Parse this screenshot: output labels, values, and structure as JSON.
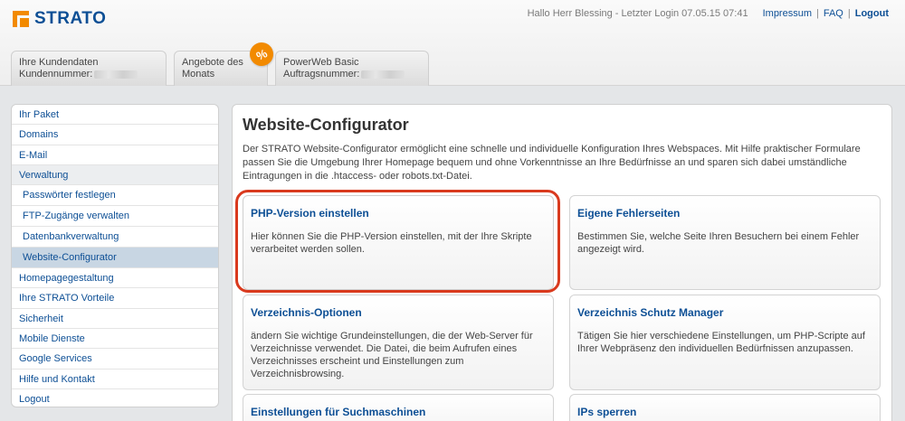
{
  "brand": {
    "name": "STRATO",
    "accent": "#f28a00",
    "link_color": "#0d4f95"
  },
  "topbar": {
    "greeting": "Hallo Herr Blessing - Letzter Login 07.05.15 07:41",
    "links": {
      "impressum": "Impressum",
      "faq": "FAQ",
      "logout": "Logout"
    },
    "separator": "|"
  },
  "tabs": [
    {
      "line1": "Ihre Kundendaten",
      "line2": "Kundennummer:"
    },
    {
      "line1": "Angebote des",
      "line2": "Monats",
      "badge": "%"
    },
    {
      "line1": "PowerWeb Basic",
      "line2": "Auftragsnummer:"
    }
  ],
  "sidebar": {
    "items": [
      {
        "label": "Ihr Paket"
      },
      {
        "label": "Domains"
      },
      {
        "label": "E-Mail"
      },
      {
        "label": "Verwaltung"
      },
      {
        "label": "Passwörter festlegen"
      },
      {
        "label": "FTP-Zugänge verwalten"
      },
      {
        "label": "Datenbankverwaltung"
      },
      {
        "label": "Website-Configurator"
      },
      {
        "label": "Homepagegestaltung"
      },
      {
        "label": "Ihre STRATO Vorteile"
      },
      {
        "label": "Sicherheit"
      },
      {
        "label": "Mobile Dienste"
      },
      {
        "label": "Google Services"
      },
      {
        "label": "Hilfe und Kontakt"
      },
      {
        "label": "Logout"
      }
    ]
  },
  "main": {
    "title": "Website-Configurator",
    "intro": "Der STRATO Website-Configurator ermöglicht eine schnelle und individuelle Konfiguration Ihres Webspaces. Mit Hilfe praktischer Formulare passen Sie die Umgebung Ihrer Homepage bequem und ohne Vorkenntnisse an Ihre Bedürfnisse an und sparen sich dabei umständliche Eintragungen in die .htaccess- oder robots.txt-Datei.",
    "cards": [
      {
        "title": "PHP-Version einstellen",
        "text": "Hier können Sie die PHP-Version einstellen, mit der Ihre Skripte verarbeitet werden sollen."
      },
      {
        "title": "Eigene Fehlerseiten",
        "text": "Bestimmen Sie, welche Seite Ihren Besuchern bei einem Fehler angezeigt wird."
      },
      {
        "title": "Verzeichnis-Optionen",
        "text": "ändern Sie wichtige Grundeinstellungen, die der Web-Server für Verzeichnisse verwendet. Die Datei, die beim Aufrufen eines Verzeichnisses erscheint und Einstellungen zum Verzeichnisbrowsing."
      },
      {
        "title": "Verzeichnis Schutz Manager",
        "text": "Tätigen Sie hier verschiedene Einstellungen, um PHP-Scripte auf Ihrer Webpräsenz den individuellen Bedürfnissen anzupassen."
      },
      {
        "title": "Einstellungen für Suchmaschinen",
        "text": ""
      },
      {
        "title": "IPs sperren",
        "text": ""
      }
    ]
  },
  "highlight_color": "#d93a1e"
}
